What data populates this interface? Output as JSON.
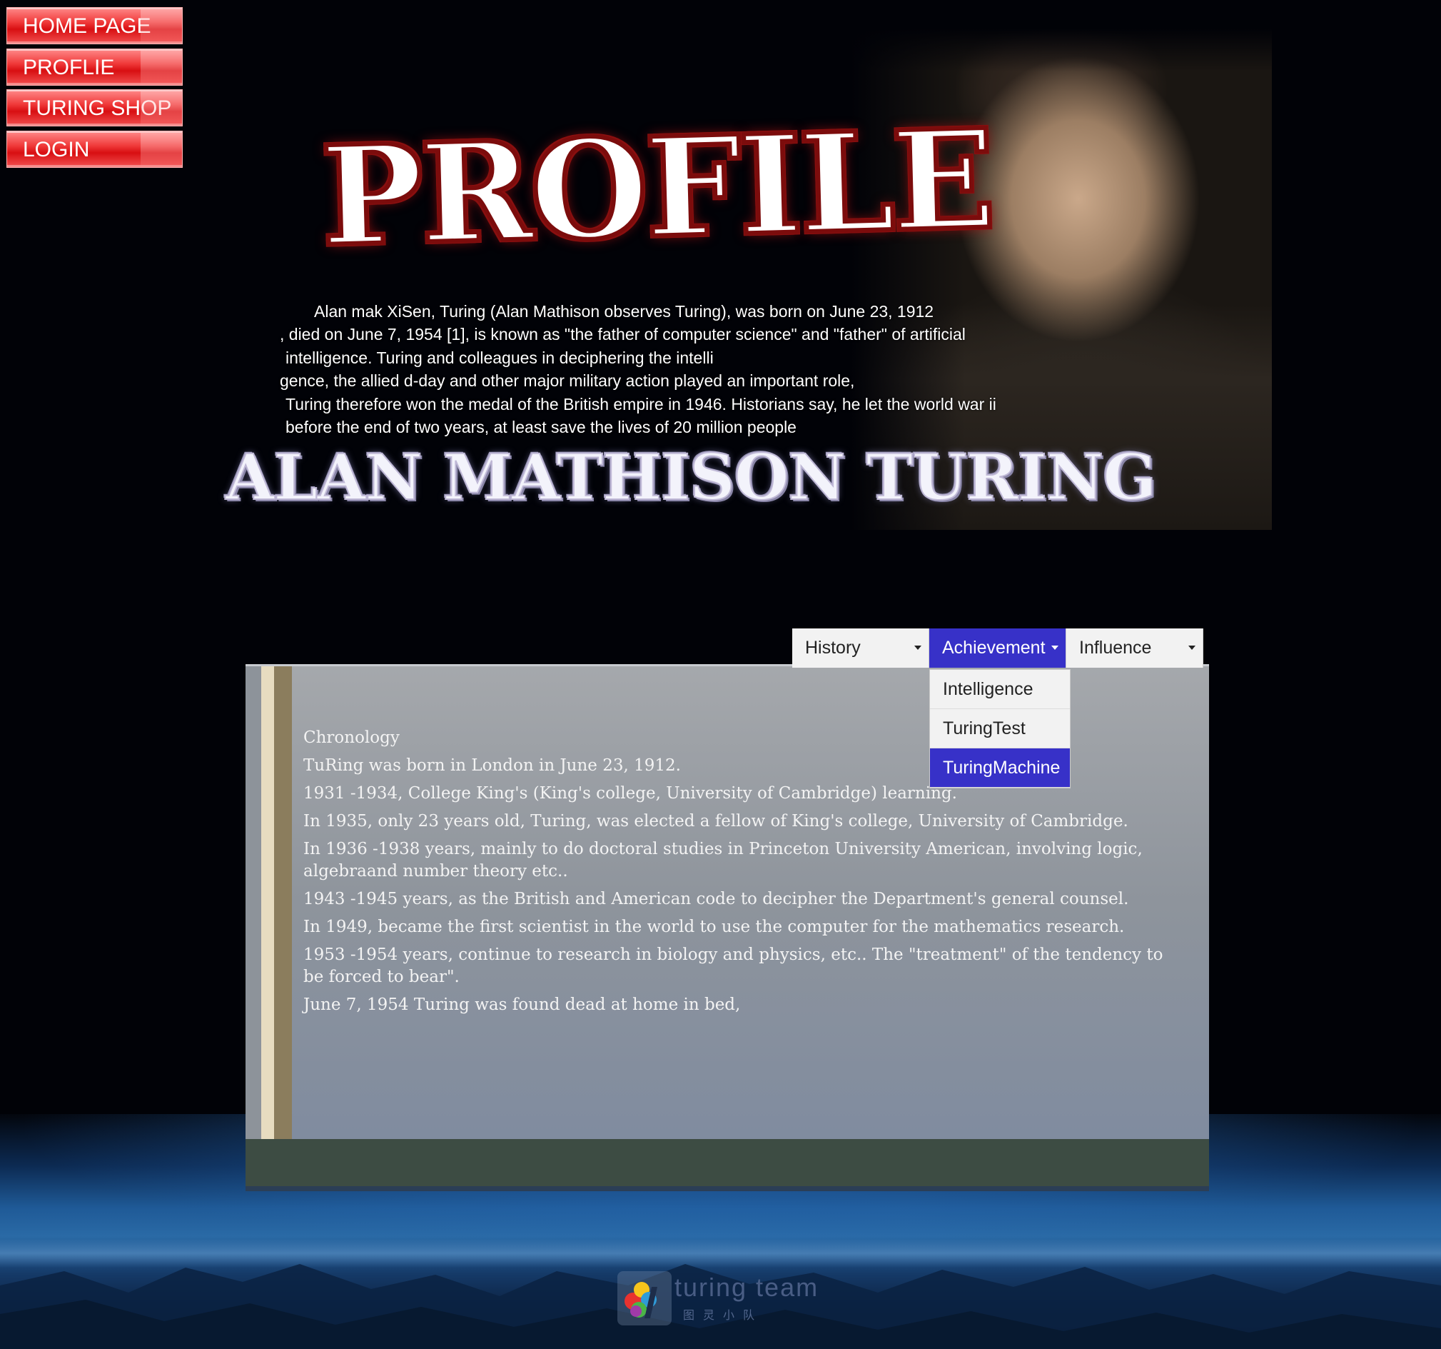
{
  "nav": {
    "items": [
      {
        "label": "HOME PAGE"
      },
      {
        "label": "PROFLIE"
      },
      {
        "label": "TURING SHOP"
      },
      {
        "label": "LOGIN"
      }
    ]
  },
  "banner": {
    "title": "PROFILE",
    "bio_lines": [
      "Alan mak XiSen, Turing (Alan Mathison observes Turing), was born on June 23, 1912",
      ", died on June 7, 1954 [1], is known as \"the father of computer science\" and \"father\" of artificial",
      "intelligence. Turing and colleagues in deciphering the intelli",
      "gence, the allied d-day and other major military action played an important role,",
      "Turing therefore won the medal of the British empire in 1946. Historians say, he let the world war ii",
      "before the end of two years, at least save the lives of 20 million people"
    ],
    "name": "ALAN MATHISON TURING"
  },
  "tabs": [
    {
      "label": "History",
      "active": false
    },
    {
      "label": "Achievement",
      "active": true
    },
    {
      "label": "Influence",
      "active": false
    }
  ],
  "dropdown": {
    "items": [
      {
        "label": "Intelligence",
        "active": false
      },
      {
        "label": "TuringTest",
        "active": false
      },
      {
        "label": "TuringMachine",
        "active": true
      }
    ]
  },
  "content": {
    "paragraphs": [
      "Chronology",
      "TuRing was born in London in June 23,  1912.",
      "1931 -1934,  College King's (King's college,  University of Cambridge) learning.",
      "In 1935,  only 23 years old,  Turing,  was elected a fellow of King's college,  University of Cambridge.",
      "In 1936 -1938 years,  mainly to do doctoral studies in Princeton University American,  involving logic,  algebraand number theory etc..",
      "1943 -1945 years,  as the British and American code to decipher the Department's general counsel.",
      "In 1949,  became the first scientist in the world to use the computer for the mathematics research.",
      "1953 -1954 years,  continue to research in biology and physics,  etc.. The \"treatment\" of the tendency to be forced to bear\".",
      "June 7, 1954 Turing was found dead at home in bed,"
    ]
  },
  "footer": {
    "logo_text": "turing team",
    "logo_sub": "图灵小队"
  },
  "colors": {
    "nav_red": "#e0181b",
    "tab_active": "#3731c8",
    "panel_bottom": "#3d4c43"
  }
}
